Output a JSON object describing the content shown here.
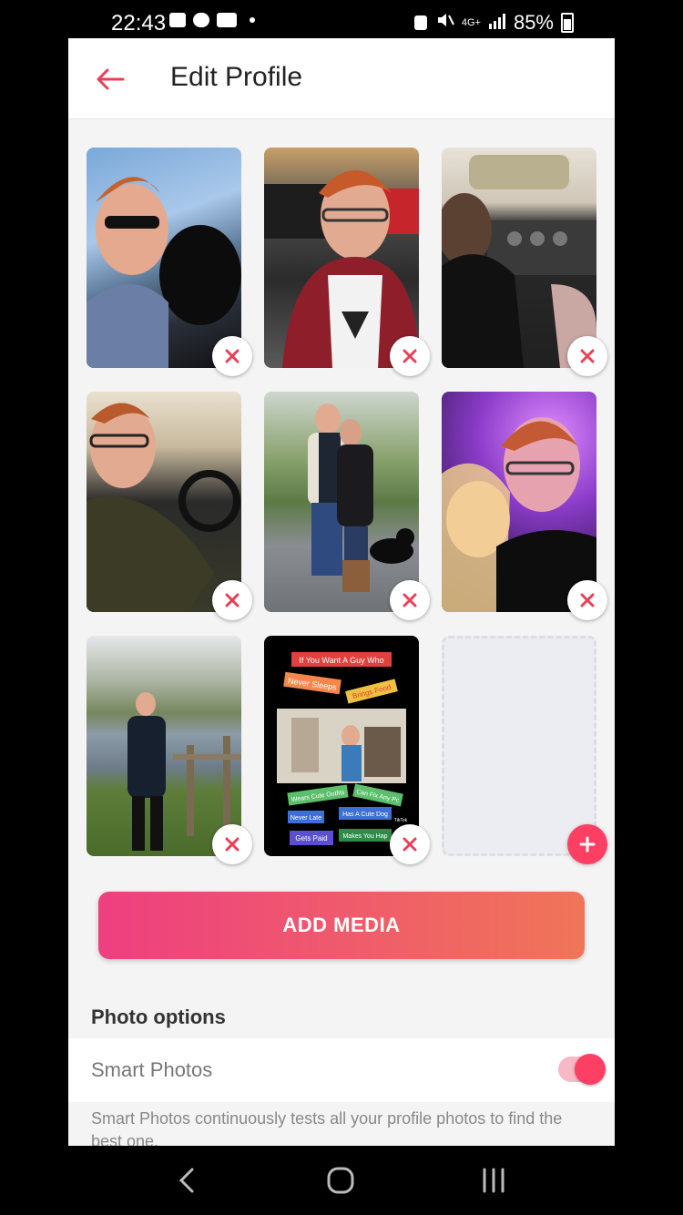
{
  "status_bar": {
    "time": "22:43",
    "battery": "85%",
    "network": "4G+",
    "icons": [
      "gallery-icon",
      "cloud-icon",
      "youtube-icon",
      "dot-icon",
      "battery-saver-icon",
      "mute-icon",
      "signal-icon",
      "battery-icon"
    ]
  },
  "header": {
    "title": "Edit Profile",
    "back_icon": "arrow-left-icon",
    "accent_color": "#e94057"
  },
  "photos": [
    {
      "label": "photo-1",
      "description_icon": "remove-icon"
    },
    {
      "label": "photo-2",
      "description_icon": "remove-icon"
    },
    {
      "label": "photo-3",
      "description_icon": "remove-icon"
    },
    {
      "label": "photo-4",
      "description_icon": "remove-icon"
    },
    {
      "label": "photo-5",
      "description_icon": "remove-icon"
    },
    {
      "label": "photo-6",
      "description_icon": "remove-icon"
    },
    {
      "label": "photo-7",
      "description_icon": "remove-icon"
    },
    {
      "label": "photo-8",
      "description_icon": "remove-icon"
    }
  ],
  "tiktok_tile": {
    "lines": [
      "If You Want A Guy Who",
      "Never Sleeps",
      "Brings Food",
      "Wears Cute Outfits",
      "Can Fix Any Pc",
      "Never Late",
      "Has A Cute Dog",
      "Gets Paid",
      "Makes You Hap"
    ],
    "watermark": "TikTok"
  },
  "empty_slot": {
    "icon": "plus-icon"
  },
  "actions": {
    "add_media": "ADD MEDIA"
  },
  "photo_options": {
    "title": "Photo options",
    "smart_photos_label": "Smart Photos",
    "smart_photos_enabled": true,
    "description": "Smart Photos continuously tests all your profile photos to find the best one."
  },
  "nav_bar": {
    "icons": [
      "back-icon",
      "home-icon",
      "recents-icon"
    ]
  },
  "colors": {
    "brand_pink": "#fd3f63",
    "gradient_start": "#ee3f80",
    "gradient_end": "#f07558"
  }
}
